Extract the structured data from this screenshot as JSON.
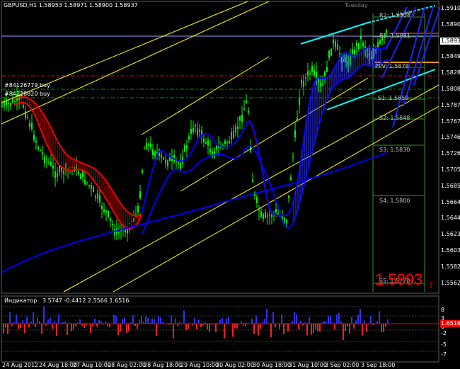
{
  "header": {
    "symbol_info": "GBPUSD,H1  1.58953 1.58971 1.58900 1.58937",
    "day": "Tuesday",
    "tz": "(GMT)"
  },
  "price_axis": {
    "labels": [
      "1.59105",
      "1.58900",
      "1.58695",
      "1.58490",
      "1.58285",
      "1.58080",
      "1.57875",
      "1.57670",
      "1.57465",
      "1.57260",
      "1.57055",
      "1.56850",
      "1.56645",
      "1.56440",
      "1.56235",
      "1.56030",
      "1.55825",
      "1.55620"
    ],
    "current_price": "1.58937"
  },
  "time_axis": {
    "labels": [
      "24 Aug 2012",
      "24 Aug 18:00",
      "27 Aug 10:00",
      "28 Aug 02:00",
      "28 Aug 18:00",
      "29 Aug 10:00",
      "30 Aug 02:00",
      "30 Aug 18:00",
      "31 Aug 10:00",
      "3 Sep 02:00",
      "3 Sep 18:00"
    ]
  },
  "orders": [
    {
      "label": "#84126779 buy"
    },
    {
      "label": "#84128820 buy"
    }
  ],
  "pivots": [
    {
      "label": "R2: 1.5904"
    },
    {
      "label": "R1: 1.5881"
    },
    {
      "label": "PPV: 1.5878"
    },
    {
      "label": "S1: 1.5859"
    },
    {
      "label": "S2: 1.5848"
    },
    {
      "label": "S3: 1.5830"
    },
    {
      "label": "S4: 1.5800"
    },
    {
      "label": "S5: 1.5770"
    }
  ],
  "big_price": {
    "main": "1.5893",
    "sub": "7"
  },
  "indicator": {
    "title": "Индикатор",
    "values": "3.5747 -0.4412 2.5566 1.6516",
    "levels": [
      "8",
      "3",
      "0",
      "-2",
      "-5",
      "-7"
    ],
    "current_tag": "1.6516"
  },
  "colors": {
    "bull_bear_candles": "#00ff00",
    "ma_red": "#ff0000",
    "ma_blue": "#0000ff",
    "channel_yellow": "#ffff00",
    "channel_cyan": "#00ffff",
    "pivot_green": "#2f8f2f"
  }
}
